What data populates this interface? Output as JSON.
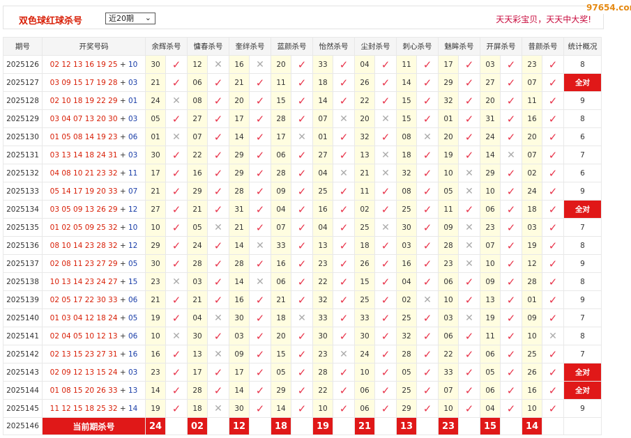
{
  "header": {
    "title": "双色球红球杀号",
    "range_select": "近20期",
    "slogan": "天天彩宝贝，天天中大奖!",
    "watermark": "97654.com"
  },
  "columns": [
    "期号",
    "开奖号码",
    "余辉杀号",
    "慵春杀号",
    "奎绊杀号",
    "蓝颜杀号",
    "怡然杀号",
    "尘封杀号",
    "刺心杀号",
    "魅眸杀号",
    "开屏杀号",
    "昔颜杀号",
    "统计概况"
  ],
  "rows": [
    {
      "period": "2025126",
      "red": "02 12 13 16 19 25",
      "blue": "10",
      "kills": [
        [
          "30",
          "v"
        ],
        [
          "12",
          "x"
        ],
        [
          "16",
          "x"
        ],
        [
          "20",
          "v"
        ],
        [
          "33",
          "v"
        ],
        [
          "04",
          "v"
        ],
        [
          "11",
          "v"
        ],
        [
          "17",
          "v"
        ],
        [
          "03",
          "v"
        ],
        [
          "23",
          "v"
        ]
      ],
      "stat": "8",
      "full": false
    },
    {
      "period": "2025127",
      "red": "03 09 15 17 19 28",
      "blue": "03",
      "kills": [
        [
          "21",
          "v"
        ],
        [
          "06",
          "v"
        ],
        [
          "21",
          "v"
        ],
        [
          "11",
          "v"
        ],
        [
          "18",
          "v"
        ],
        [
          "26",
          "v"
        ],
        [
          "14",
          "v"
        ],
        [
          "29",
          "v"
        ],
        [
          "27",
          "v"
        ],
        [
          "07",
          "v"
        ]
      ],
      "stat": "全对",
      "full": true
    },
    {
      "period": "2025128",
      "red": "02 10 18 19 22 29",
      "blue": "01",
      "kills": [
        [
          "24",
          "x"
        ],
        [
          "08",
          "v"
        ],
        [
          "20",
          "v"
        ],
        [
          "15",
          "v"
        ],
        [
          "14",
          "v"
        ],
        [
          "22",
          "v"
        ],
        [
          "15",
          "v"
        ],
        [
          "32",
          "v"
        ],
        [
          "20",
          "v"
        ],
        [
          "11",
          "v"
        ]
      ],
      "stat": "9",
      "full": false
    },
    {
      "period": "2025129",
      "red": "03 04 07 13 20 30",
      "blue": "03",
      "kills": [
        [
          "05",
          "v"
        ],
        [
          "27",
          "v"
        ],
        [
          "17",
          "v"
        ],
        [
          "28",
          "v"
        ],
        [
          "07",
          "x"
        ],
        [
          "20",
          "x"
        ],
        [
          "15",
          "v"
        ],
        [
          "01",
          "v"
        ],
        [
          "31",
          "v"
        ],
        [
          "16",
          "v"
        ]
      ],
      "stat": "8",
      "full": false
    },
    {
      "period": "2025130",
      "red": "01 05 08 14 19 23",
      "blue": "06",
      "kills": [
        [
          "01",
          "x"
        ],
        [
          "07",
          "v"
        ],
        [
          "14",
          "v"
        ],
        [
          "17",
          "x"
        ],
        [
          "01",
          "v"
        ],
        [
          "32",
          "v"
        ],
        [
          "08",
          "x"
        ],
        [
          "20",
          "v"
        ],
        [
          "24",
          "v"
        ],
        [
          "20",
          "v"
        ]
      ],
      "stat": "6",
      "full": false
    },
    {
      "period": "2025131",
      "red": "03 13 14 18 24 31",
      "blue": "03",
      "kills": [
        [
          "30",
          "v"
        ],
        [
          "22",
          "v"
        ],
        [
          "29",
          "v"
        ],
        [
          "06",
          "v"
        ],
        [
          "27",
          "v"
        ],
        [
          "13",
          "x"
        ],
        [
          "18",
          "v"
        ],
        [
          "19",
          "v"
        ],
        [
          "14",
          "x"
        ],
        [
          "07",
          "v"
        ]
      ],
      "stat": "7",
      "full": false
    },
    {
      "period": "2025132",
      "red": "04 08 10 21 23 32",
      "blue": "11",
      "kills": [
        [
          "17",
          "v"
        ],
        [
          "16",
          "v"
        ],
        [
          "29",
          "v"
        ],
        [
          "28",
          "v"
        ],
        [
          "04",
          "x"
        ],
        [
          "21",
          "x"
        ],
        [
          "32",
          "v"
        ],
        [
          "10",
          "x"
        ],
        [
          "29",
          "v"
        ],
        [
          "02",
          "v"
        ]
      ],
      "stat": "6",
      "full": false
    },
    {
      "period": "2025133",
      "red": "05 14 17 19 20 33",
      "blue": "07",
      "kills": [
        [
          "21",
          "v"
        ],
        [
          "29",
          "v"
        ],
        [
          "28",
          "v"
        ],
        [
          "09",
          "v"
        ],
        [
          "25",
          "v"
        ],
        [
          "11",
          "v"
        ],
        [
          "08",
          "v"
        ],
        [
          "05",
          "x"
        ],
        [
          "10",
          "v"
        ],
        [
          "24",
          "v"
        ]
      ],
      "stat": "9",
      "full": false
    },
    {
      "period": "2025134",
      "red": "03 05 09 13 26 29",
      "blue": "12",
      "kills": [
        [
          "27",
          "v"
        ],
        [
          "21",
          "v"
        ],
        [
          "31",
          "v"
        ],
        [
          "04",
          "v"
        ],
        [
          "16",
          "v"
        ],
        [
          "02",
          "v"
        ],
        [
          "25",
          "v"
        ],
        [
          "11",
          "v"
        ],
        [
          "06",
          "v"
        ],
        [
          "18",
          "v"
        ]
      ],
      "stat": "全对",
      "full": true
    },
    {
      "period": "2025135",
      "red": "01 02 05 09 25 32",
      "blue": "10",
      "kills": [
        [
          "10",
          "v"
        ],
        [
          "05",
          "x"
        ],
        [
          "21",
          "v"
        ],
        [
          "07",
          "v"
        ],
        [
          "04",
          "v"
        ],
        [
          "25",
          "x"
        ],
        [
          "30",
          "v"
        ],
        [
          "09",
          "x"
        ],
        [
          "23",
          "v"
        ],
        [
          "03",
          "v"
        ]
      ],
      "stat": "7",
      "full": false
    },
    {
      "period": "2025136",
      "red": "08 10 14 23 28 32",
      "blue": "12",
      "kills": [
        [
          "29",
          "v"
        ],
        [
          "24",
          "v"
        ],
        [
          "14",
          "x"
        ],
        [
          "33",
          "v"
        ],
        [
          "13",
          "v"
        ],
        [
          "18",
          "v"
        ],
        [
          "03",
          "v"
        ],
        [
          "28",
          "x"
        ],
        [
          "07",
          "v"
        ],
        [
          "19",
          "v"
        ]
      ],
      "stat": "8",
      "full": false
    },
    {
      "period": "2025137",
      "red": "02 08 11 23 27 29",
      "blue": "05",
      "kills": [
        [
          "30",
          "v"
        ],
        [
          "28",
          "v"
        ],
        [
          "28",
          "v"
        ],
        [
          "16",
          "v"
        ],
        [
          "23",
          "v"
        ],
        [
          "26",
          "v"
        ],
        [
          "16",
          "v"
        ],
        [
          "23",
          "x"
        ],
        [
          "10",
          "v"
        ],
        [
          "12",
          "v"
        ]
      ],
      "stat": "9",
      "full": false
    },
    {
      "period": "2025138",
      "red": "10 13 14 23 24 27",
      "blue": "15",
      "kills": [
        [
          "23",
          "x"
        ],
        [
          "03",
          "v"
        ],
        [
          "14",
          "x"
        ],
        [
          "06",
          "v"
        ],
        [
          "22",
          "v"
        ],
        [
          "15",
          "v"
        ],
        [
          "04",
          "v"
        ],
        [
          "06",
          "v"
        ],
        [
          "09",
          "v"
        ],
        [
          "28",
          "v"
        ]
      ],
      "stat": "8",
      "full": false
    },
    {
      "period": "2025139",
      "red": "02 05 17 22 30 33",
      "blue": "06",
      "kills": [
        [
          "21",
          "v"
        ],
        [
          "21",
          "v"
        ],
        [
          "16",
          "v"
        ],
        [
          "21",
          "v"
        ],
        [
          "32",
          "v"
        ],
        [
          "25",
          "v"
        ],
        [
          "02",
          "x"
        ],
        [
          "10",
          "v"
        ],
        [
          "13",
          "v"
        ],
        [
          "01",
          "v"
        ]
      ],
      "stat": "9",
      "full": false
    },
    {
      "period": "2025140",
      "red": "01 03 04 12 18 24",
      "blue": "05",
      "kills": [
        [
          "19",
          "v"
        ],
        [
          "04",
          "x"
        ],
        [
          "30",
          "v"
        ],
        [
          "18",
          "x"
        ],
        [
          "33",
          "v"
        ],
        [
          "33",
          "v"
        ],
        [
          "25",
          "v"
        ],
        [
          "03",
          "x"
        ],
        [
          "19",
          "v"
        ],
        [
          "09",
          "v"
        ]
      ],
      "stat": "7",
      "full": false
    },
    {
      "period": "2025141",
      "red": "02 04 05 10 12 13",
      "blue": "06",
      "kills": [
        [
          "10",
          "x"
        ],
        [
          "30",
          "v"
        ],
        [
          "03",
          "v"
        ],
        [
          "20",
          "v"
        ],
        [
          "30",
          "v"
        ],
        [
          "30",
          "v"
        ],
        [
          "32",
          "v"
        ],
        [
          "06",
          "v"
        ],
        [
          "11",
          "v"
        ],
        [
          "10",
          "x"
        ]
      ],
      "stat": "8",
      "full": false
    },
    {
      "period": "2025142",
      "red": "02 13 15 23 27 31",
      "blue": "16",
      "kills": [
        [
          "16",
          "v"
        ],
        [
          "13",
          "x"
        ],
        [
          "09",
          "v"
        ],
        [
          "15",
          "v"
        ],
        [
          "23",
          "x"
        ],
        [
          "24",
          "v"
        ],
        [
          "28",
          "v"
        ],
        [
          "22",
          "v"
        ],
        [
          "06",
          "v"
        ],
        [
          "25",
          "v"
        ]
      ],
      "stat": "7",
      "full": false
    },
    {
      "period": "2025143",
      "red": "02 09 12 13 15 24",
      "blue": "03",
      "kills": [
        [
          "23",
          "v"
        ],
        [
          "17",
          "v"
        ],
        [
          "17",
          "v"
        ],
        [
          "05",
          "v"
        ],
        [
          "28",
          "v"
        ],
        [
          "10",
          "v"
        ],
        [
          "05",
          "v"
        ],
        [
          "33",
          "v"
        ],
        [
          "05",
          "v"
        ],
        [
          "26",
          "v"
        ]
      ],
      "stat": "全对",
      "full": true
    },
    {
      "period": "2025144",
      "red": "01 08 15 20 26 33",
      "blue": "13",
      "kills": [
        [
          "14",
          "v"
        ],
        [
          "28",
          "v"
        ],
        [
          "14",
          "v"
        ],
        [
          "29",
          "v"
        ],
        [
          "22",
          "v"
        ],
        [
          "06",
          "v"
        ],
        [
          "25",
          "v"
        ],
        [
          "07",
          "v"
        ],
        [
          "06",
          "v"
        ],
        [
          "16",
          "v"
        ]
      ],
      "stat": "全对",
      "full": true
    },
    {
      "period": "2025145",
      "red": "11 12 15 18 25 32",
      "blue": "14",
      "kills": [
        [
          "19",
          "v"
        ],
        [
          "18",
          "x"
        ],
        [
          "30",
          "v"
        ],
        [
          "14",
          "v"
        ],
        [
          "10",
          "v"
        ],
        [
          "06",
          "v"
        ],
        [
          "29",
          "v"
        ],
        [
          "10",
          "v"
        ],
        [
          "04",
          "v"
        ],
        [
          "10",
          "v"
        ]
      ],
      "stat": "9",
      "full": false
    }
  ],
  "current": {
    "period": "2025146",
    "label": "当前期杀号",
    "kills": [
      "24",
      "02",
      "12",
      "18",
      "19",
      "21",
      "13",
      "23",
      "15",
      "14"
    ]
  },
  "icons": {
    "correct": "check-icon",
    "wrong": "cross-icon"
  },
  "colors": {
    "accent_red": "#e01818",
    "kill_bg": "#fffde0",
    "blue_ball": "#1a3ea8"
  }
}
